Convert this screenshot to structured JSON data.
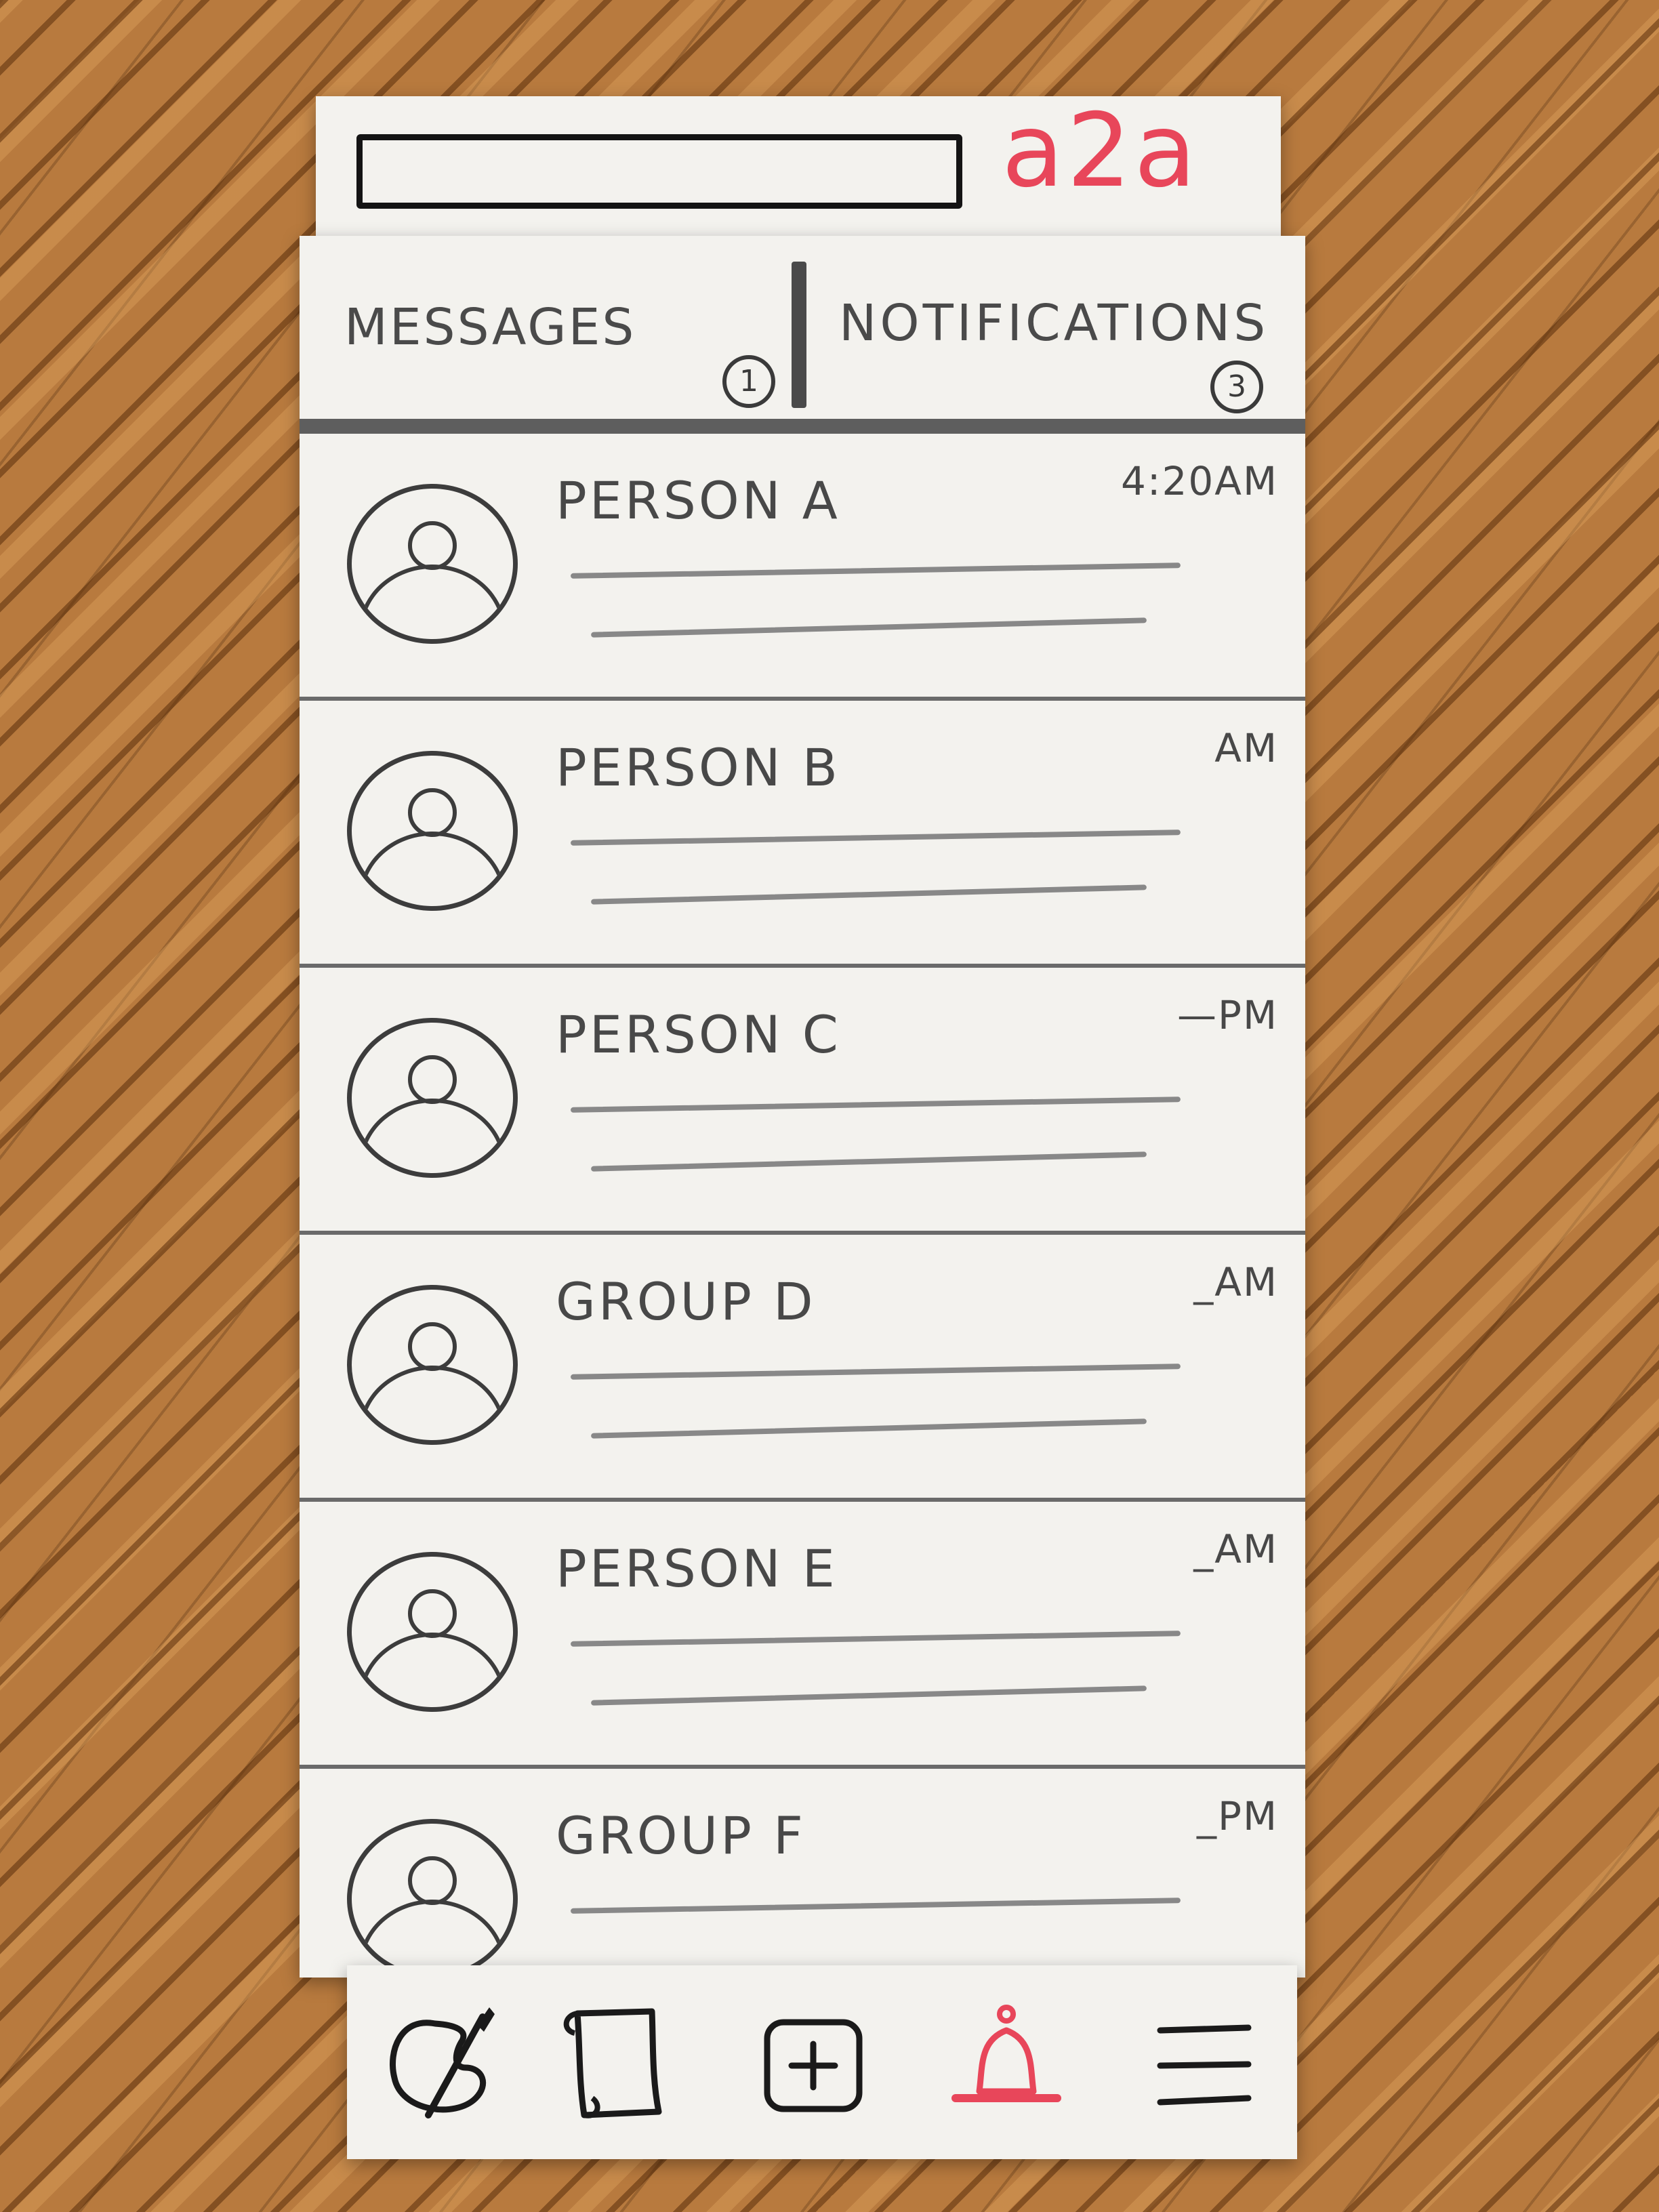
{
  "header": {
    "logo": "a2a",
    "logo_color": "#e8465a"
  },
  "tabs": {
    "messages": {
      "label": "MESSAGES",
      "badge": "1"
    },
    "notifications": {
      "label": "NOTIFICATIONS",
      "badge": "3"
    }
  },
  "conversations": [
    {
      "name": "PERSON A",
      "time": "4:20AM"
    },
    {
      "name": "PERSON B",
      "time": "AM"
    },
    {
      "name": "PERSON C",
      "time": "—PM"
    },
    {
      "name": "GROUP D",
      "time": "_AM"
    },
    {
      "name": "PERSON E",
      "time": "_AM"
    },
    {
      "name": "GROUP F",
      "time": "_PM"
    }
  ],
  "bottom_nav": {
    "items": [
      {
        "icon": "palette-brush-icon"
      },
      {
        "icon": "scroll-icon"
      },
      {
        "icon": "plus-square-icon"
      },
      {
        "icon": "bell-icon",
        "active": true
      },
      {
        "icon": "hamburger-menu-icon"
      }
    ],
    "active_color": "#e8465a",
    "icon_color": "#1a1a1a"
  }
}
